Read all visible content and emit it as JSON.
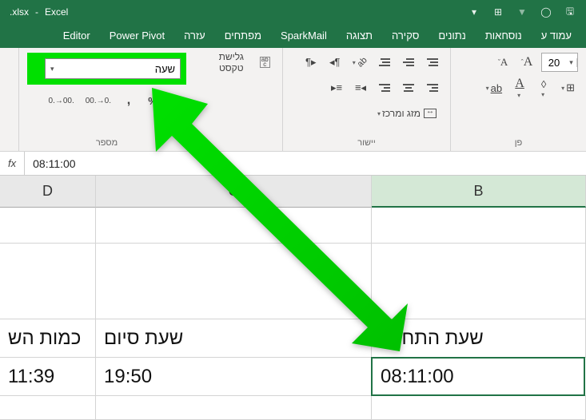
{
  "title": {
    "filename": ".xlsx",
    "app": "Excel"
  },
  "tabs": [
    "עמוד ע",
    "נוסחאות",
    "נתונים",
    "סקירה",
    "תצוגה",
    "SparkMail",
    "מפתחים",
    "עזרה",
    "Power Pivot",
    "Editor"
  ],
  "ribbon": {
    "font": {
      "size": "20",
      "increase": "A",
      "decrease": "A",
      "color": "A",
      "fill": "◊",
      "underline": "U"
    },
    "align": {
      "merge_label": "מזג ומרכז",
      "wrap_label": "גלישת טקסט",
      "group_label": "יישור"
    },
    "number": {
      "format": "שעה",
      "percent": "%",
      "thousand": ",",
      "group_label": "מספר"
    }
  },
  "formula_bar": {
    "fx": "fx",
    "value": "08:11:00"
  },
  "columns": [
    "D",
    "C",
    "B"
  ],
  "grid": {
    "headers": {
      "D": "כמות הש",
      "C": "שעת סיום",
      "B": "שעת התחלה"
    },
    "data": {
      "D": "11:39",
      "C": "19:50",
      "B": "08:11:00"
    }
  }
}
